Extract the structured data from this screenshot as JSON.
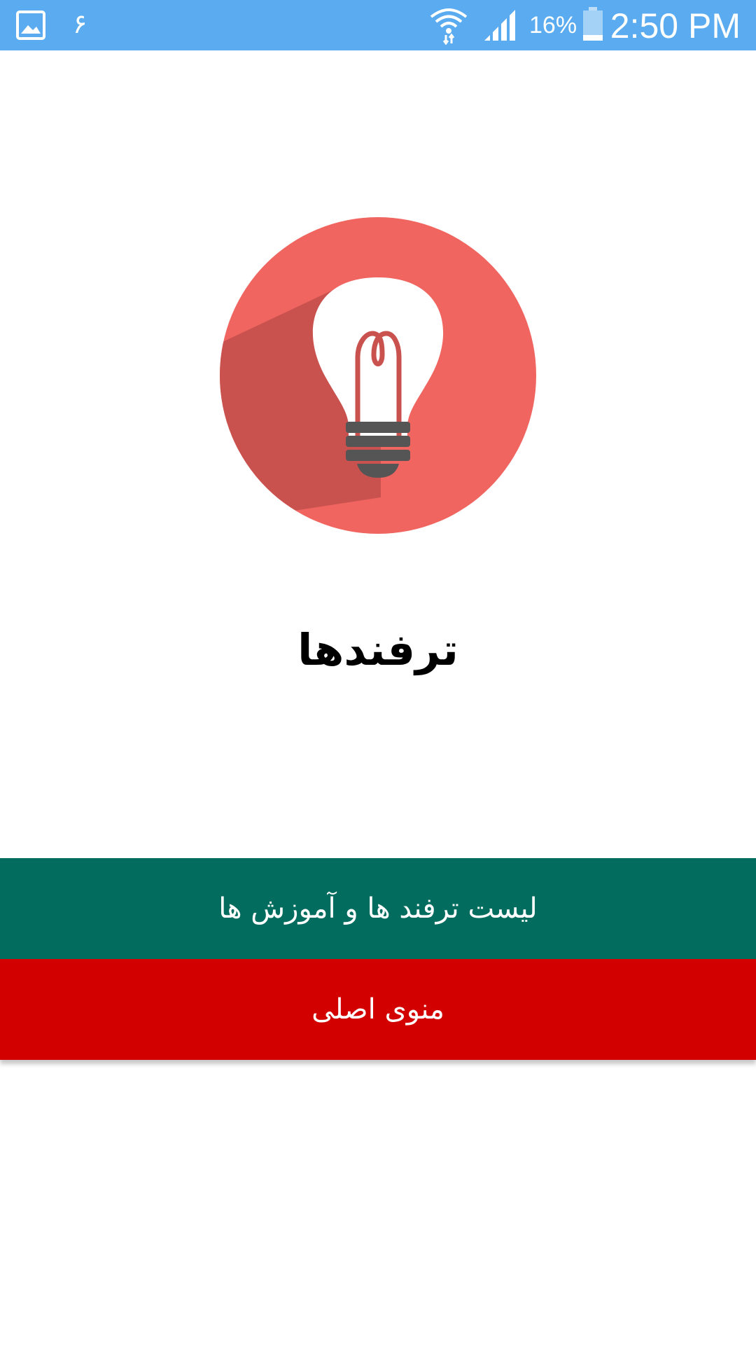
{
  "status_bar": {
    "notification_digit": "۶",
    "battery_percent": "16%",
    "time": "2:50 PM",
    "background_color": "#5aabef",
    "icons": [
      "gallery-icon",
      "wifi-icon",
      "signal-icon",
      "battery-icon"
    ]
  },
  "logo": {
    "icon": "lightbulb-icon",
    "circle_color": "#f06560",
    "shadow_color": "#c9524f",
    "bulb_color": "#ffffff"
  },
  "title": "ترفندها",
  "buttons": {
    "list_label": "لیست ترفند ها و آموزش ها",
    "list_color": "#026d5e",
    "menu_label": "منوی اصلی",
    "menu_color": "#d30000"
  }
}
